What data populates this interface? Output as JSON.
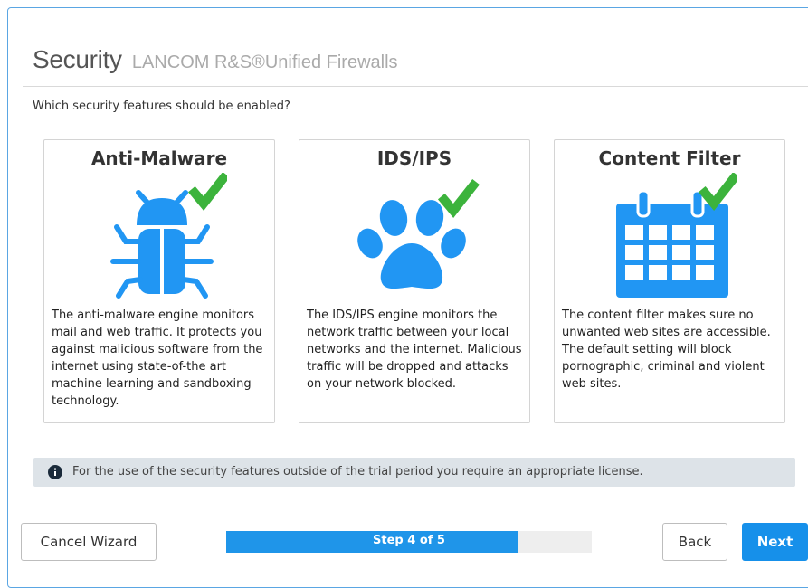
{
  "header": {
    "title": "Security",
    "subtitle": "LANCOM R&S®Unified Firewalls"
  },
  "question": "Which security features should be enabled?",
  "features": [
    {
      "title": "Anti-Malware",
      "icon": "bug-icon",
      "enabled": true,
      "description": "The anti-malware engine monitors mail and web traffic. It protects you against malicious software from the internet using state-of-the art machine learning and sandboxing technology."
    },
    {
      "title": "IDS/IPS",
      "icon": "paw-icon",
      "enabled": true,
      "description": "The IDS/IPS engine monitors the network traffic between your local networks and the internet. Malicious traffic will be dropped and attacks on your network blocked."
    },
    {
      "title": "Content Filter",
      "icon": "calendar-icon",
      "enabled": true,
      "description": "The content filter makes sure no unwanted web sites are accessible. The default setting will block pornographic, criminal and violent web sites."
    }
  ],
  "info": {
    "icon": "info-circle-icon",
    "text": "For the use of the security features outside of the trial period you require an appropriate license."
  },
  "footer": {
    "cancel_label": "Cancel Wizard",
    "progress_label": "Step 4 of 5",
    "progress_fraction": 0.8,
    "back_label": "Back",
    "next_label": "Next"
  },
  "colors": {
    "accent": "#1f95e9",
    "icon_blue": "#2196f3",
    "check_green": "#3cb33c",
    "info_bar": "#dde3e8"
  }
}
